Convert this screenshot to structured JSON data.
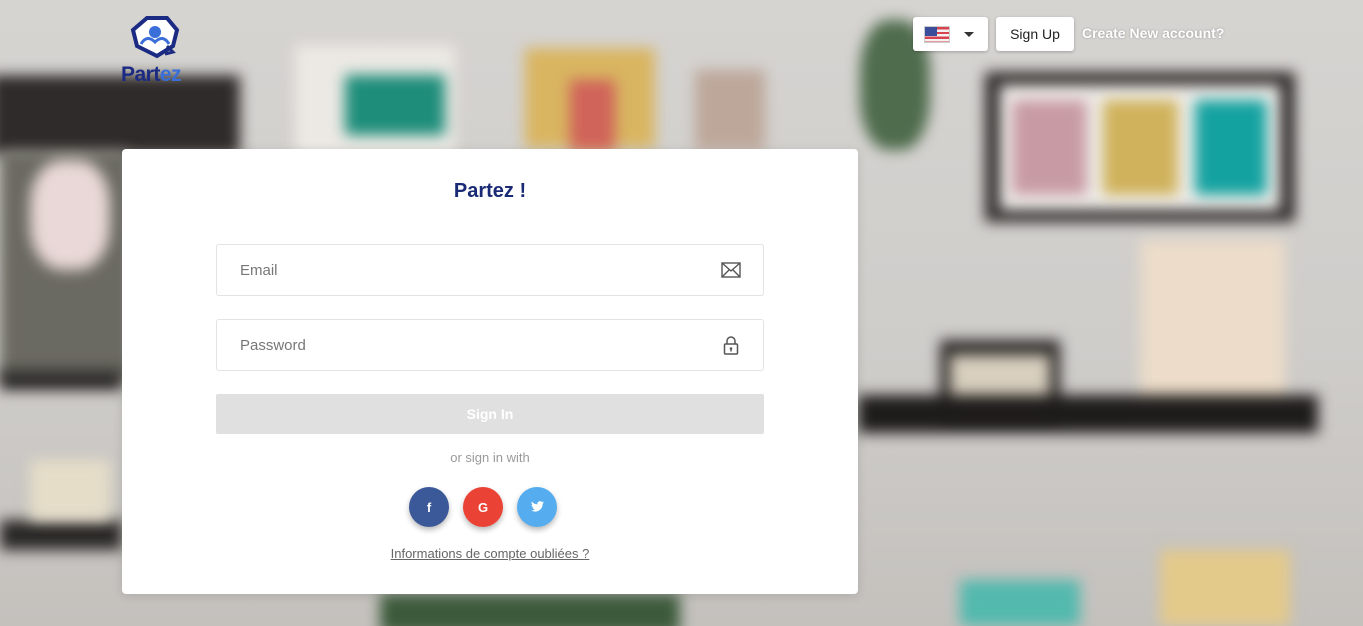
{
  "header": {
    "logo_text_main": "Part",
    "logo_text_accent": "ez",
    "language": {
      "selected": "United States flag",
      "icon": "us-flag-icon"
    },
    "signup_label": "Sign Up",
    "create_account_link": "Create New account?"
  },
  "login": {
    "title": "Partez !",
    "email_placeholder": "Email",
    "password_placeholder": "Password",
    "signin_label": "Sign In",
    "or_text": "or sign in with",
    "social": [
      {
        "label": "f",
        "icon": "facebook-icon",
        "color": "#3b5998"
      },
      {
        "label": "G",
        "icon": "google-icon",
        "color": "#ea4335"
      },
      {
        "label": "t",
        "icon": "twitter-icon",
        "color": "#55acee"
      }
    ],
    "forgot_link": "Informations de compte oubliées ?"
  },
  "colors": {
    "brand": "#1b2a83",
    "title": "#1b2a74",
    "signin_disabled": "#e0e0e0"
  }
}
